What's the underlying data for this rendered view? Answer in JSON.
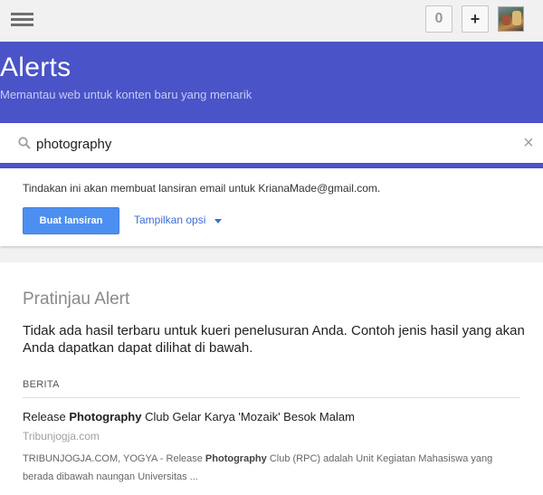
{
  "topbar": {
    "notification_count": "0",
    "share_label": "+"
  },
  "header": {
    "title": "Alerts",
    "subtitle": "Memantau web untuk konten baru yang menarik"
  },
  "search": {
    "value": "photography",
    "clear_label": "×"
  },
  "options": {
    "note": "Tindakan ini akan membuat lansiran email untuk KrianaMade@gmail.com.",
    "create_button": "Buat lansiran",
    "show_options": "Tampilkan opsi"
  },
  "preview": {
    "title": "Pratinjau Alert",
    "message": "Tidak ada hasil terbaru untuk kueri penelusuran Anda. Contoh jenis hasil yang akan Anda dapatkan dapat dilihat di bawah.",
    "section_label": "BERITA",
    "result": {
      "title_before": "Release ",
      "title_bold": "Photography",
      "title_after": " Club Gelar Karya 'Mozaik' Besok Malam",
      "source": "Tribunjogja.com",
      "snippet_before": "TRIBUNJOGJA.COM, YOGYA - Release ",
      "snippet_bold": "Photography",
      "snippet_after": " Club (RPC) adalah Unit Kegiatan Mahasiswa yang berada dibawah naungan Universitas ..."
    }
  },
  "colors": {
    "header_blue": "#4a53c8",
    "button_blue": "#4d8ff0",
    "link_blue": "#3d6dd6"
  },
  "icons": [
    "menu-icon",
    "search-icon",
    "close-icon",
    "caret-down-icon",
    "avatar"
  ]
}
